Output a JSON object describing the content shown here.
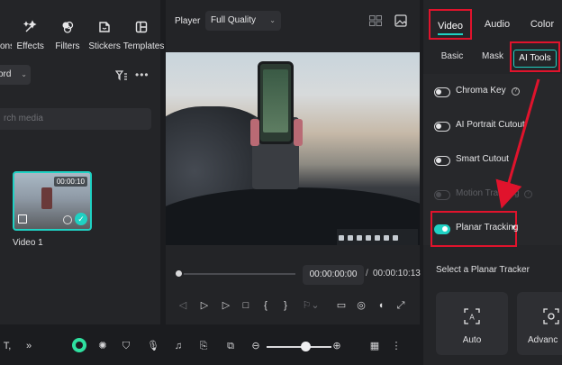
{
  "library": {
    "tabs": [
      {
        "label": "ons",
        "icon": "media-icon"
      },
      {
        "label": "Effects",
        "icon": "effects-icon"
      },
      {
        "label": "Filters",
        "icon": "filters-icon"
      },
      {
        "label": "Stickers",
        "icon": "stickers-icon"
      },
      {
        "label": "Templates",
        "icon": "templates-icon"
      }
    ],
    "record_dropdown": "ord",
    "search_placeholder": "rch media",
    "clip": {
      "name": "Video 1",
      "duration": "00:00:10"
    }
  },
  "player": {
    "label": "Player",
    "quality": "Full Quality",
    "current_time": "00:00:00:00",
    "separator": "/",
    "total_time": "00:00:10:13",
    "progress_fraction": 0
  },
  "properties": {
    "top_tabs": [
      "Video",
      "Audio",
      "Color"
    ],
    "active_top_tab": "Video",
    "sub_tabs": [
      "Basic",
      "Mask",
      "AI Tools"
    ],
    "active_sub_tab": "AI Tools",
    "ai_tools": [
      {
        "label": "Chroma Key",
        "help": true,
        "enabled": false,
        "disabled": false
      },
      {
        "label": "AI Portrait Cutout",
        "help": false,
        "enabled": false,
        "disabled": false
      },
      {
        "label": "Smart Cutout",
        "help": false,
        "enabled": false,
        "disabled": false
      },
      {
        "label": "Motion Tracking",
        "help": true,
        "enabled": false,
        "disabled": true
      },
      {
        "label": "Planar Tracking",
        "help": false,
        "enabled": true,
        "disabled": false,
        "expand": "▾"
      }
    ],
    "tracker_section_label": "Select a Planar Tracker",
    "trackers": [
      {
        "label": "Auto",
        "icon": "auto-track-icon"
      },
      {
        "label": "Advanc",
        "icon": "advanced-track-icon"
      }
    ],
    "help_glyph": "?"
  },
  "toolbar": {
    "text_tool_glyph": "T,",
    "more_glyph": "»"
  },
  "colors": {
    "accent": "#1fd1c3",
    "highlight": "#e0132c",
    "panel_bg": "#242528",
    "app_bg": "#1b1c1f"
  }
}
